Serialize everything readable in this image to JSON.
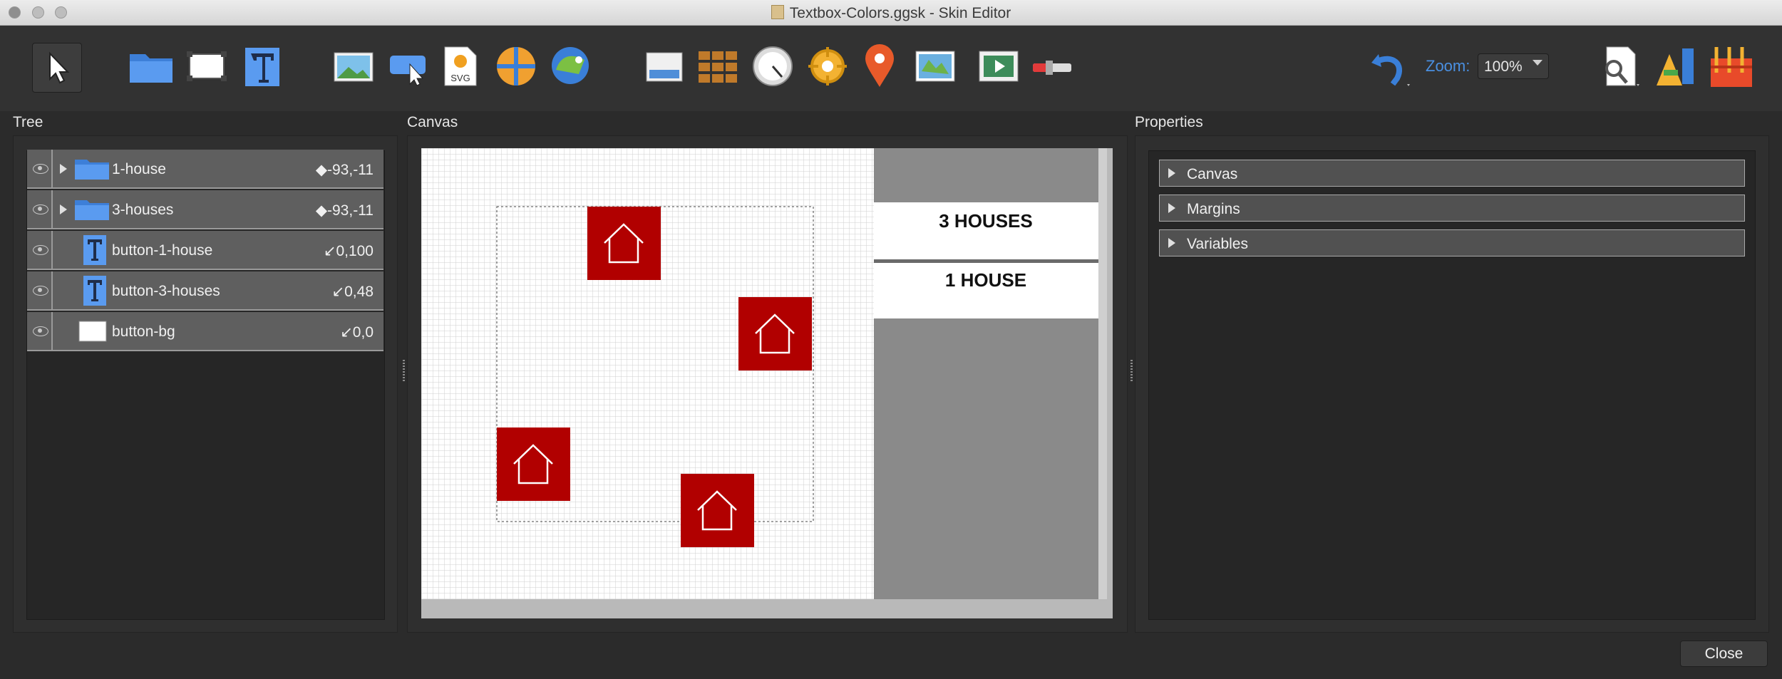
{
  "window": {
    "title": "Textbox-Colors.ggsk - Skin Editor"
  },
  "toolbar": {
    "zoom_label": "Zoom:",
    "zoom_value": "100%",
    "svg_label": "SVG"
  },
  "panels": {
    "tree_title": "Tree",
    "canvas_title": "Canvas",
    "properties_title": "Properties"
  },
  "tree": {
    "items": [
      {
        "label": "1-house",
        "coord": "◆-93,-11",
        "expandable": true,
        "icon": "folder-icon"
      },
      {
        "label": "3-houses",
        "coord": "◆-93,-11",
        "expandable": true,
        "icon": "folder-icon"
      },
      {
        "label": "button-1-house",
        "coord": "↙0,100",
        "expandable": false,
        "icon": "text-icon"
      },
      {
        "label": "button-3-houses",
        "coord": "↙0,48",
        "expandable": false,
        "icon": "text-icon"
      },
      {
        "label": "button-bg",
        "coord": "↙0,0",
        "expandable": false,
        "icon": "rectangle-icon"
      }
    ]
  },
  "canvas": {
    "buttons": {
      "three_houses": "3 HOUSES",
      "one_house": "1 HOUSE"
    },
    "accent_color": "#b10000"
  },
  "properties": {
    "sections": [
      "Canvas",
      "Margins",
      "Variables"
    ]
  },
  "footer": {
    "close_label": "Close"
  }
}
